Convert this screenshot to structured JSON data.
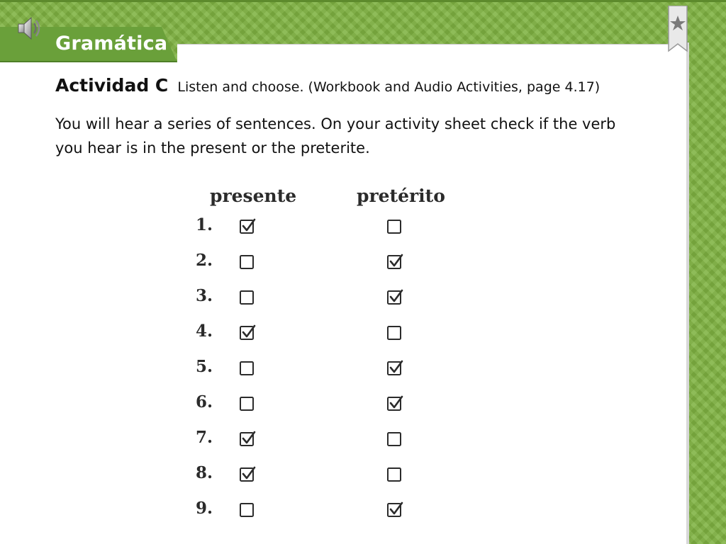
{
  "section_tab": {
    "title": "Gramática",
    "speaker_icon": "speaker-icon",
    "bookmark_icon": "bookmark-icon"
  },
  "activity": {
    "title": "Actividad C",
    "subtitle": "Listen and choose. (Workbook and Audio Activities, page 4.17)",
    "instructions": "You will hear a series of sentences. On your activity sheet check if the verb you hear is in the present or the preterite."
  },
  "answer_sheet": {
    "columns": [
      "presente",
      "pretérito"
    ],
    "rows": [
      {
        "number": "1.",
        "presente": true,
        "preterito": false
      },
      {
        "number": "2.",
        "presente": false,
        "preterito": true
      },
      {
        "number": "3.",
        "presente": false,
        "preterito": true
      },
      {
        "number": "4.",
        "presente": true,
        "preterito": false
      },
      {
        "number": "5.",
        "presente": false,
        "preterito": true
      },
      {
        "number": "6.",
        "presente": false,
        "preterito": true
      },
      {
        "number": "7.",
        "presente": true,
        "preterito": false
      },
      {
        "number": "8.",
        "presente": true,
        "preterito": false
      },
      {
        "number": "9.",
        "presente": false,
        "preterito": true
      }
    ]
  },
  "colors": {
    "frame_green": "#7fb241",
    "tab_green": "#6aa03a",
    "text": "#111111"
  }
}
